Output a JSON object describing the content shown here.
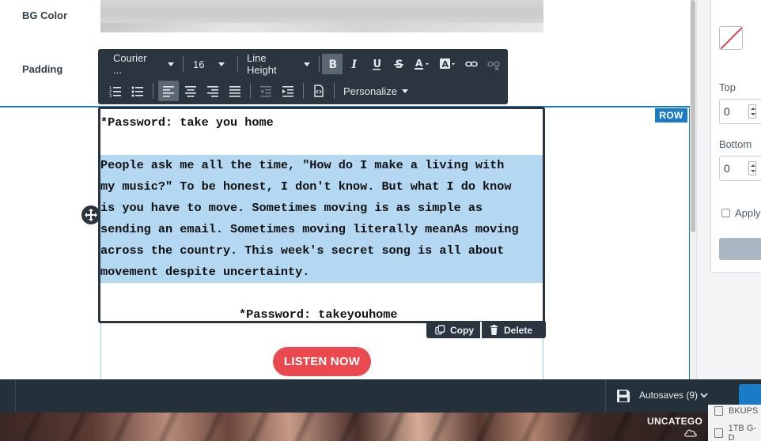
{
  "toolbar": {
    "font_family": "Courier ...",
    "font_size": "16",
    "line_height_label": "Line Height",
    "personalize_label": "Personalize"
  },
  "editor": {
    "password_line_1": "*Password: take you home",
    "body_lines": [
      "People ask me all the time, \"How do I make a living with",
      "my music?\" To be honest, I don't know. But what I do know",
      "is you have to move. Sometimes moving is as simple as",
      "sending an email. Sometimes moving literally meanAs moving",
      "across the country. This week's secret song is all about",
      "movement despite uncertainty."
    ],
    "password_line_2_prefix": "*Password: ",
    "password_line_2_word": "takeyouhome"
  },
  "actions": {
    "copy_label": "Copy",
    "delete_label": "Delete"
  },
  "row_badge": "ROW",
  "listen_button": "LISTEN NOW",
  "panel": {
    "bg_color_label": "BG Color",
    "padding_label": "Padding",
    "top_label": "Top",
    "top_value": "0",
    "bottom_label": "Bottom",
    "bottom_value": "0",
    "apply_label": "Apply"
  },
  "bottom_bar": {
    "autosaves_label": "Autosaves (9)"
  },
  "background": {
    "category_label": "UNCATEGO",
    "drive_items": [
      "BKUPS",
      "1TB G-D"
    ]
  },
  "colors": {
    "accent": "#1a7cc7",
    "toolbar_bg": "#2a3540",
    "selection": "#b4d7f2",
    "listen_button": "#ea4a4f"
  }
}
